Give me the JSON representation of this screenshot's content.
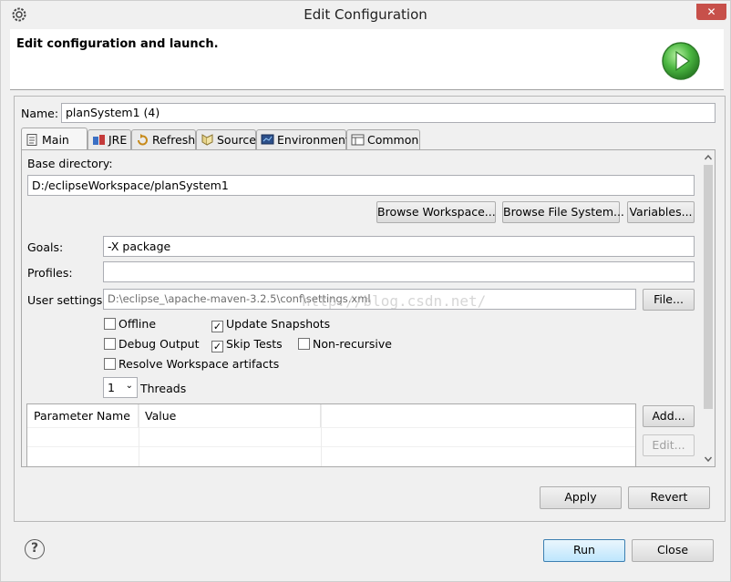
{
  "window": {
    "title": "Edit Configuration",
    "close_glyph": "✕"
  },
  "header": {
    "title": "Edit configuration and launch."
  },
  "name": {
    "label": "Name:",
    "value": "planSystem1 (4)"
  },
  "tabs": [
    {
      "label": "Main",
      "icon": "main-tab-icon",
      "active": true
    },
    {
      "label": "JRE",
      "icon": "jre-icon"
    },
    {
      "label": "Refresh",
      "icon": "refresh-icon"
    },
    {
      "label": "Source",
      "icon": "source-icon"
    },
    {
      "label": "Environment",
      "icon": "environment-icon"
    },
    {
      "label": "Common",
      "icon": "common-icon"
    }
  ],
  "main": {
    "base_dir_label": "Base directory:",
    "base_dir_value": "D:/eclipseWorkspace/planSystem1",
    "browse_workspace": "Browse Workspace...",
    "browse_fs": "Browse File System...",
    "variables": "Variables...",
    "goals_label": "Goals:",
    "goals_value": "-X package",
    "profiles_label": "Profiles:",
    "profiles_value": "",
    "user_settings_label": "User settings:",
    "user_settings_value": "D:\\eclipse_\\apache-maven-3.2.5\\conf\\settings.xml",
    "file_button": "File...",
    "offline": "Offline",
    "update_snapshots": "Update Snapshots",
    "debug_output": "Debug Output",
    "skip_tests": "Skip Tests",
    "non_recursive": "Non-recursive",
    "resolve_workspace": "Resolve Workspace artifacts",
    "threads_value": "1",
    "threads_label": "Threads",
    "param_col_name": "Parameter Name",
    "param_col_value": "Value",
    "add_button": "Add...",
    "edit_button": "Edit..."
  },
  "checkbox_checked_glyph": "✓",
  "dropdown_glyph": "⌄",
  "watermark": "http://blog.csdn.net/",
  "actions": {
    "apply": "Apply",
    "revert": "Revert",
    "run": "Run",
    "close": "Close"
  },
  "help_glyph": "?",
  "colors": {
    "run_logo": "#3fae3a",
    "close_button": "#c7504a"
  }
}
